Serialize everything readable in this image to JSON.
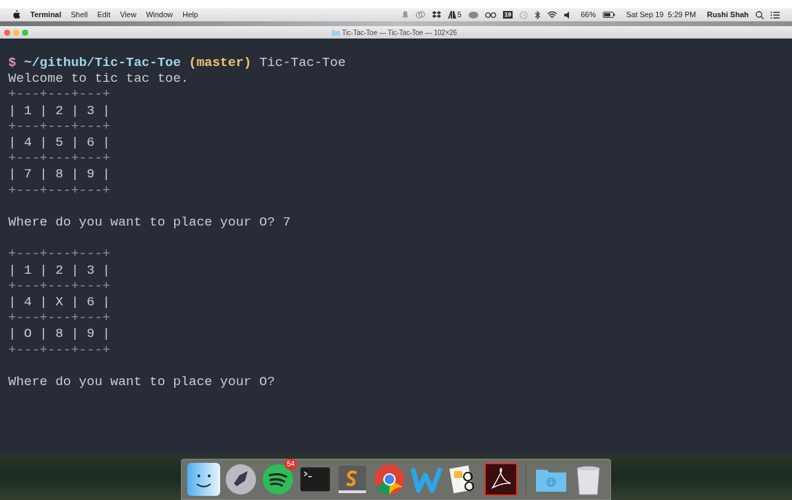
{
  "menu_bar": {
    "app": "Terminal",
    "menus": [
      "Shell",
      "Edit",
      "View",
      "Window",
      "Help"
    ],
    "status": {
      "adobe_count": "5",
      "calendar_day": "19",
      "battery": "66%",
      "datetime": "Sat Sep 19  5:29 PM",
      "user": "Rushi Shah"
    }
  },
  "window": {
    "title": "Tic-Tac-Toe — Tic-Tac-Toe — 102×26"
  },
  "terminal": {
    "prompt": {
      "symbol": "$",
      "path": "~/github/Tic-Tac-Toe",
      "branch": "(master)",
      "command": "Tic-Tac-Toe"
    },
    "lines": [
      {
        "kind": "output",
        "text": "Welcome to tic tac toe."
      },
      {
        "kind": "border",
        "text": "+---+---+---+"
      },
      {
        "kind": "output",
        "text": "| 1 | 2 | 3 |"
      },
      {
        "kind": "border",
        "text": "+---+---+---+"
      },
      {
        "kind": "output",
        "text": "| 4 | 5 | 6 |"
      },
      {
        "kind": "border",
        "text": "+---+---+---+"
      },
      {
        "kind": "output",
        "text": "| 7 | 8 | 9 |"
      },
      {
        "kind": "border",
        "text": "+---+---+---+"
      },
      {
        "kind": "blank"
      },
      {
        "kind": "output",
        "text": "Where do you want to place your O? 7"
      },
      {
        "kind": "blank"
      },
      {
        "kind": "border",
        "text": "+---+---+---+"
      },
      {
        "kind": "output",
        "text": "| 1 | 2 | 3 |"
      },
      {
        "kind": "border",
        "text": "+---+---+---+"
      },
      {
        "kind": "output",
        "text": "| 4 | X | 6 |"
      },
      {
        "kind": "border",
        "text": "+---+---+---+"
      },
      {
        "kind": "output",
        "text": "| O | 8 | 9 |"
      },
      {
        "kind": "border",
        "text": "+---+---+---+"
      },
      {
        "kind": "blank"
      },
      {
        "kind": "output",
        "text": "Where do you want to place your O?"
      }
    ]
  },
  "dock": {
    "badge": "54"
  }
}
